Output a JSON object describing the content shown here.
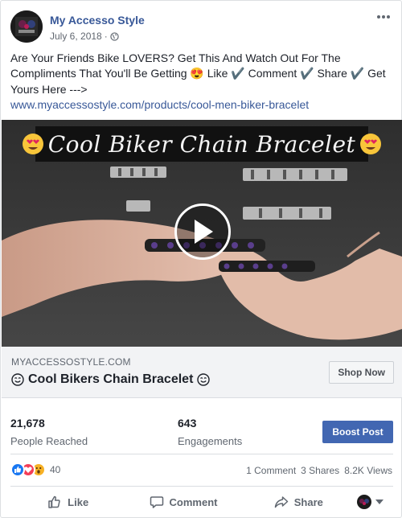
{
  "post": {
    "page_name": "My Accesso Style",
    "date": "July 6, 2018",
    "date_separator": "·",
    "privacy_icon": "globe-icon",
    "more_icon": "ellipsis-icon",
    "text": "Are Your Friends Bike LOVERS? Get This And Watch Out For The Compliments That You'll Be Getting 😍 Like ✔️ Comment ✔️ Share ✔️ Get Yours Here --->",
    "link": "www.myaccessostyle.com/products/cool-men-biker-bracelet"
  },
  "video": {
    "banner_title": "Cool Biker Chain Bracelet",
    "banner_emoji": "heart-eyes-emoji",
    "play_icon": "play-icon"
  },
  "preview": {
    "domain": "MYACCESSOSTYLE.COM",
    "title": "Cool Bikers Chain Bracelet",
    "title_emoji": "smiling-face-emoji",
    "cta_label": "Shop Now"
  },
  "insights": {
    "reached_value": "21,678",
    "reached_label": "People Reached",
    "engagements_value": "643",
    "engagements_label": "Engagements",
    "boost_label": "Boost Post"
  },
  "reactions": {
    "types": [
      "like",
      "love",
      "wow"
    ],
    "count": "40",
    "comments": "1 Comment",
    "shares": "3 Shares",
    "views": "8.2K Views"
  },
  "actions": {
    "like_label": "Like",
    "comment_label": "Comment",
    "share_label": "Share"
  },
  "colors": {
    "link_blue": "#385898",
    "boost_blue": "#4267b2",
    "like_blue": "#1877f2",
    "love_red": "#f33e58",
    "wow_yellow": "#f7b125"
  }
}
